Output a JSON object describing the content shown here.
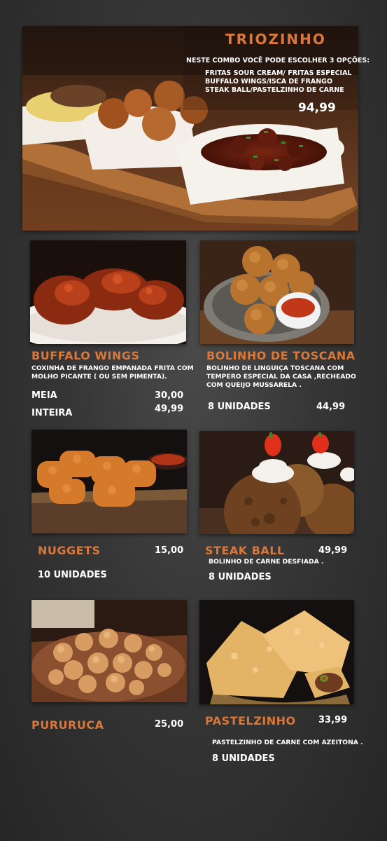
{
  "combo": {
    "title": "TRIOZINHO",
    "intro": "NESTE COMBO VOCÊ PODE ESCOLHER 3 OPÇÕES:",
    "options": [
      "FRITAS SOUR CREAM/ FRITAS ESPECIAL",
      "BUFFALO WINGS/ISCA DE FRANGO",
      "STEAK BALL/PASTELZINHO DE CARNE"
    ],
    "price": "94,99"
  },
  "buffalo": {
    "title": "BUFFALO WINGS",
    "desc": "COXINHA DE FRANGO EMPANADA FRITA COM\n MOLHO PICANTE ( OU SEM PIMENTA).",
    "size1": "MEIA",
    "price1": "30,00",
    "size2": "INTEIRA",
    "price2": "49,99"
  },
  "bolinho": {
    "title": "BOLINHO DE TOSCANA",
    "desc": "BOLINHO DE LINGUIÇA TOSCANA COM\nTEMPERO ESPECIAL DA CASA ,RECHEADO\nCOM QUEIJO MUSSARELA .",
    "qty": "8 UNIDADES",
    "price": "44,99"
  },
  "nuggets": {
    "title": "NUGGETS",
    "price": "15,00",
    "qty": "10 UNIDADES"
  },
  "steak": {
    "title": "STEAK BALL",
    "price": "49,99",
    "desc": "BOLINHO DE CARNE DESFIADA .",
    "qty": "8 UNIDADES"
  },
  "pururuca": {
    "title": "PURURUCA",
    "price": "25,00"
  },
  "pastel": {
    "title": "PASTELZINHO",
    "price": "33,99",
    "desc": "PASTELZINHO DE CARNE COM AZEITONA .",
    "qty": "8 UNIDADES"
  },
  "colors": {
    "accent": "#d9783a",
    "text": "#ffffff",
    "background": "#363636"
  }
}
